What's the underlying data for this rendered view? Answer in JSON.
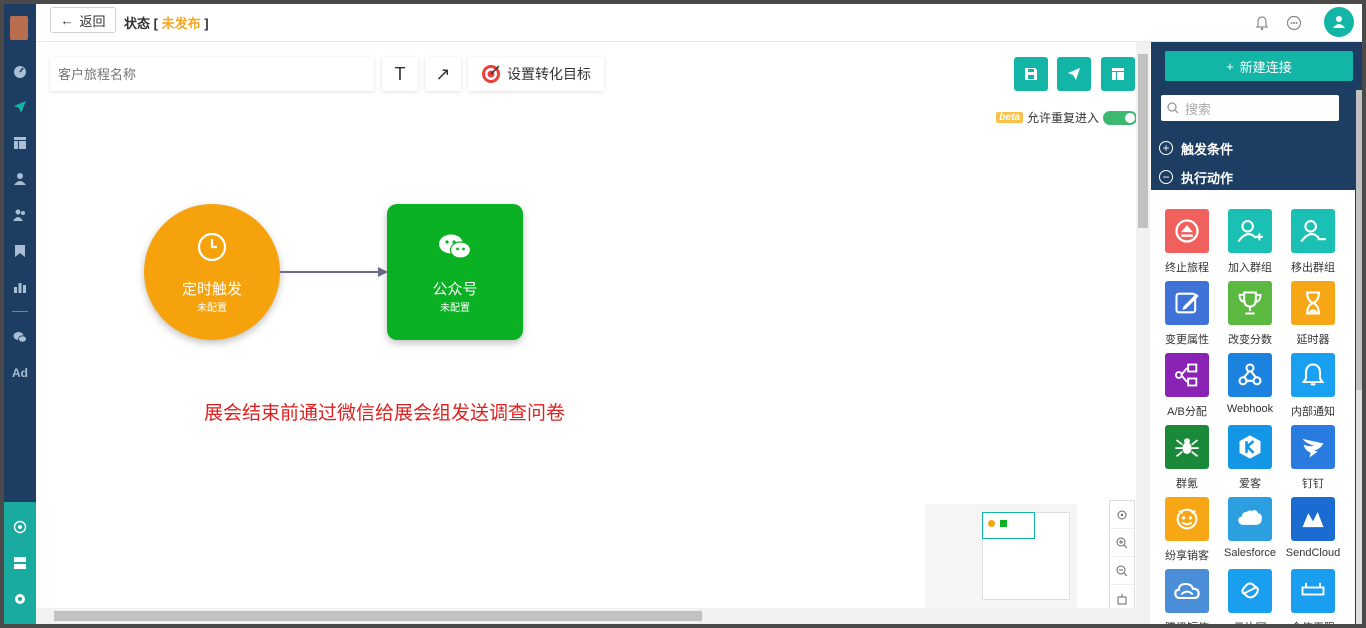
{
  "topbar": {
    "back_label": "返回",
    "status_prefix": "状态 [",
    "status_value": "未发布",
    "status_suffix": "]"
  },
  "toolbar": {
    "journey_name_placeholder": "客户旅程名称",
    "text_tool": "T",
    "arrow_tool": "↗",
    "goal_label": "设置转化目标",
    "beta_badge": "beta",
    "repeat_entry_label": "允许重复进入",
    "repeat_entry_enabled": true
  },
  "nodes": [
    {
      "title": "定时触发",
      "subtitle": "未配置",
      "color": "#f6a20c",
      "icon": "clock-icon"
    },
    {
      "title": "公众号",
      "subtitle": "未配置",
      "color": "#09b123",
      "icon": "wechat-icon"
    }
  ],
  "canvas_note": "展会结束前通过微信给展会组发送调查问卷",
  "right_panel": {
    "new_connection_label": "新建连接",
    "search_placeholder": "搜索",
    "section_triggers": "触发条件",
    "section_actions": "执行动作",
    "actions": [
      {
        "label": "终止旅程",
        "color": "#f0605d",
        "icon": "stop-icon"
      },
      {
        "label": "加入群组",
        "color": "#1ac0b3",
        "icon": "user-add-icon"
      },
      {
        "label": "移出群组",
        "color": "#1ac0b3",
        "icon": "user-remove-icon"
      },
      {
        "label": "变更属性",
        "color": "#3f73d8",
        "icon": "edit-icon"
      },
      {
        "label": "改变分数",
        "color": "#5bb941",
        "icon": "trophy-icon"
      },
      {
        "label": "延时器",
        "color": "#f7a715",
        "icon": "hourglass-icon"
      },
      {
        "label": "A/B分配",
        "color": "#8a22b5",
        "icon": "ab-split-icon"
      },
      {
        "label": "Webhook",
        "color": "#1b82e0",
        "icon": "webhook-icon"
      },
      {
        "label": "内部通知",
        "color": "#1aa0f0",
        "icon": "bell-icon"
      },
      {
        "label": "群氪",
        "color": "#1a8a3a",
        "icon": "spider-icon"
      },
      {
        "label": "爱客",
        "color": "#1496e6",
        "icon": "aike-icon"
      },
      {
        "label": "钉钉",
        "color": "#2a7be0",
        "icon": "dingtalk-icon"
      },
      {
        "label": "纷享销客",
        "color": "#f7a715",
        "icon": "fxiaoke-icon"
      },
      {
        "label": "Salesforce",
        "color": "#2b9fe0",
        "icon": "salesforce-icon"
      },
      {
        "label": "SendCloud",
        "color": "#1a6cd0",
        "icon": "sendcloud-icon"
      },
      {
        "label": "腾讯短信",
        "color": "#4a8ed8",
        "icon": "cloud-icon"
      },
      {
        "label": "云片网",
        "color": "#1a9ef0",
        "icon": "yunpian-icon"
      },
      {
        "label": "企信无限",
        "color": "#1a9ef0",
        "icon": "qixin-icon"
      }
    ]
  }
}
